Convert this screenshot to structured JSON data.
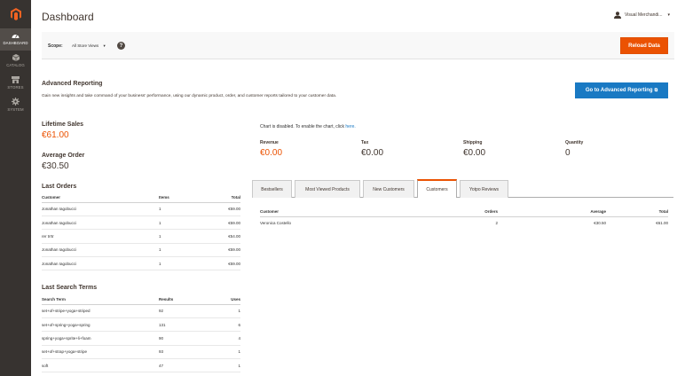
{
  "sidebar": {
    "items": [
      {
        "label": "DASHBOARD",
        "icon": "dashboard-icon"
      },
      {
        "label": "CATALOG",
        "icon": "catalog-icon"
      },
      {
        "label": "STORES",
        "icon": "stores-icon"
      },
      {
        "label": "SYSTEM",
        "icon": "system-icon"
      }
    ]
  },
  "header": {
    "title": "Dashboard",
    "user_name": "Visual Merchandi...",
    "caret": "▾"
  },
  "scope": {
    "label": "Scope:",
    "selected": "All Store Views",
    "caret": "▾",
    "help": "?",
    "reload_label": "Reload Data"
  },
  "advanced": {
    "title": "Advanced Reporting",
    "description": "Gain new insights and take command of your business' performance, using our dynamic product, order, and customer reports tailored to your customer data.",
    "button_label": "Go to Advanced Reporting",
    "button_ext": "⧉"
  },
  "lifetime": {
    "label": "Lifetime Sales",
    "value": "€61.00"
  },
  "average": {
    "label": "Average Order",
    "value": "€30.50"
  },
  "last_orders": {
    "title": "Last Orders",
    "columns": [
      "Customer",
      "Items",
      "Total"
    ],
    "rows": [
      [
        "Jonathan Iagobucci",
        "1",
        "€59.00"
      ],
      [
        "Jonathan Iagobucci",
        "1",
        "€59.00"
      ],
      [
        "rer trrtr",
        "1",
        "€54.00"
      ],
      [
        "Jonathan Iagobucci",
        "1",
        "€59.00"
      ],
      [
        "Jonathan Iagobucci",
        "1",
        "€59.00"
      ]
    ]
  },
  "last_search": {
    "title": "Last Search Terms",
    "columns": [
      "Search Term",
      "Results",
      "Uses"
    ],
    "rows": [
      [
        "set+of+stripe+yoga+striped",
        "92",
        "1"
      ],
      [
        "set+of+spring+yoga+spring",
        "131",
        "6"
      ],
      [
        "spring+yoga+sprite+li+foam",
        "90",
        "4"
      ],
      [
        "set+of+strap+yoga+stripe",
        "93",
        "1"
      ],
      [
        "soft",
        "47",
        "1"
      ]
    ]
  },
  "chart": {
    "note": "Chart is disabled. To enable the chart, click",
    "link": "here."
  },
  "totals": [
    {
      "label": "Revenue",
      "value": "€0.00",
      "accent": true
    },
    {
      "label": "Tax",
      "value": "€0.00",
      "accent": false
    },
    {
      "label": "Shipping",
      "value": "€0.00",
      "accent": false
    },
    {
      "label": "Quantity",
      "value": "0",
      "accent": false
    }
  ],
  "tabs": [
    "Bestsellers",
    "Most Viewed Products",
    "New Customers",
    "Customers",
    "Yotpo Reviews"
  ],
  "active_tab": "Customers",
  "customers_grid": {
    "columns": [
      "Customer",
      "Orders",
      "Average",
      "Total"
    ],
    "rows": [
      [
        "Veronica Costello",
        "2",
        "€30.50",
        "€61.00"
      ]
    ]
  },
  "colors": {
    "accent": "#eb5202",
    "primary": "#1979c3",
    "sidebar": "#373330"
  }
}
